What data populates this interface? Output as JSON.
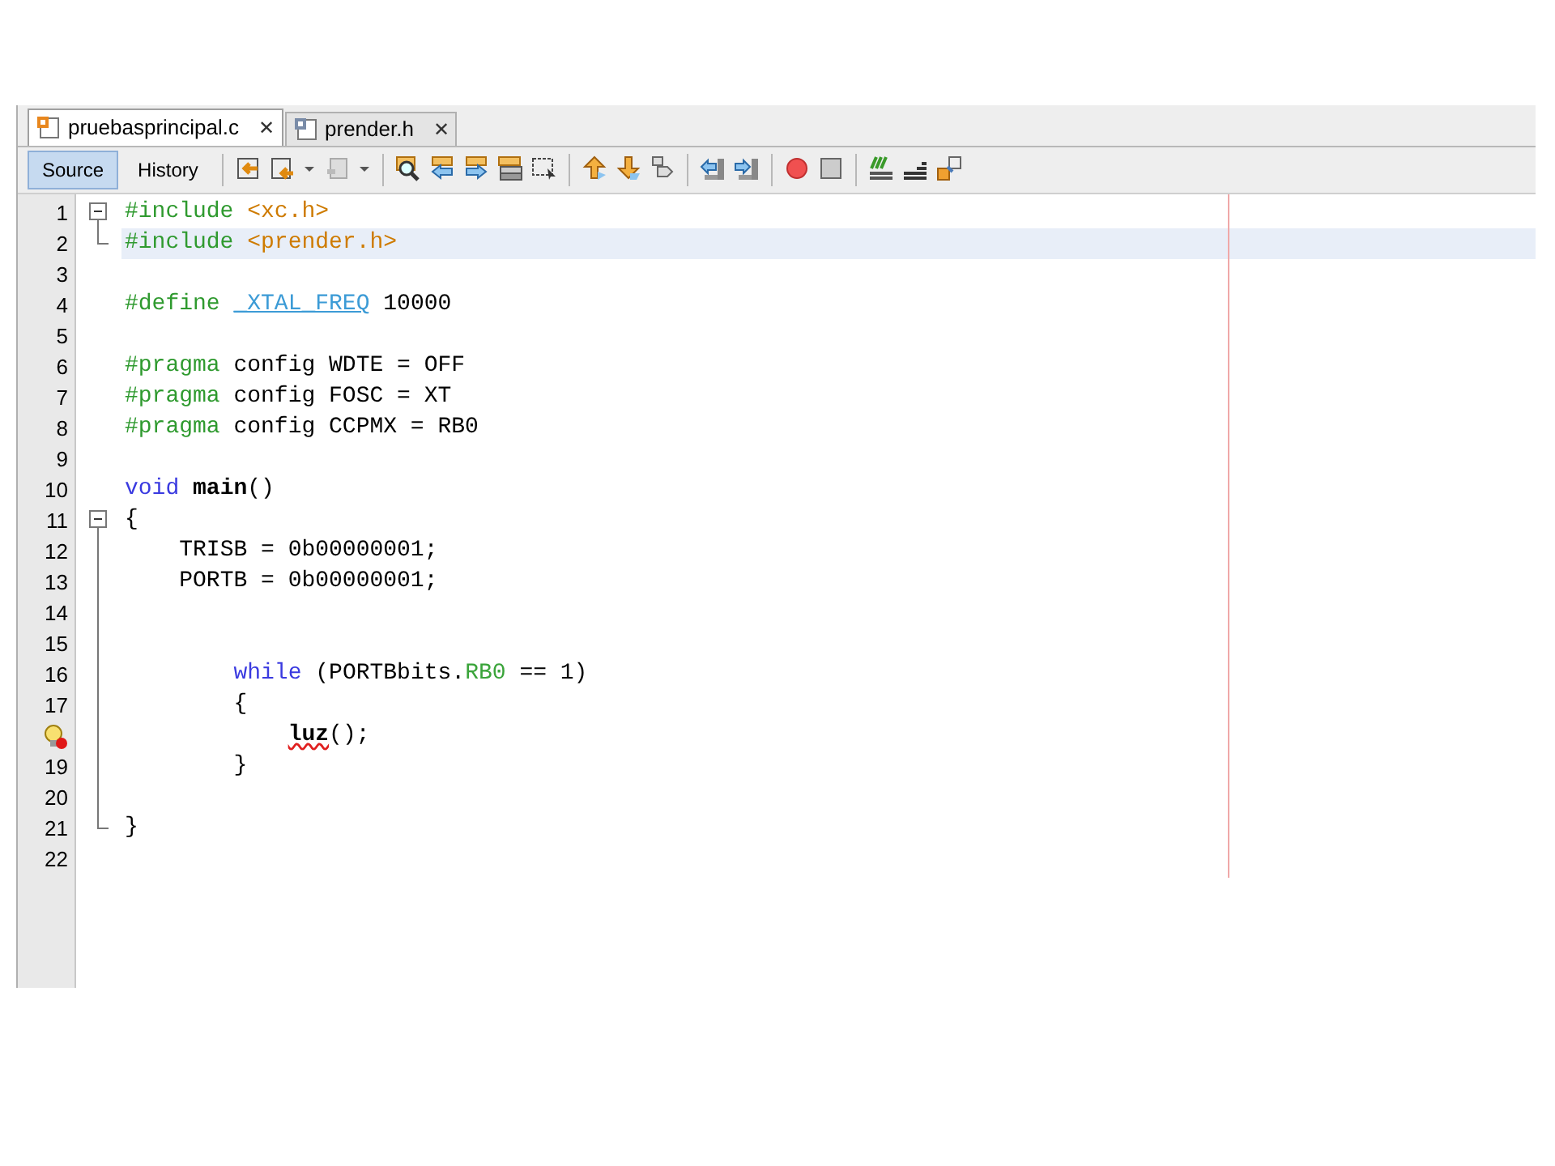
{
  "tabs": [
    {
      "label": "pruebasprincipal.c",
      "selected": true,
      "close": "✕"
    },
    {
      "label": "prender.h",
      "selected": false,
      "close": "✕"
    }
  ],
  "view_buttons": [
    {
      "label": "Source",
      "selected": true
    },
    {
      "label": "History",
      "selected": false
    }
  ],
  "lines": [
    {
      "number": "1",
      "collapsible": true,
      "current": false,
      "tokens": [
        {
          "kind": "preproc",
          "text": "#include"
        },
        {
          "kind": "string",
          "text": " <xc.h>"
        }
      ]
    },
    {
      "number": "2",
      "fold_end": true,
      "current": true,
      "tokens": [
        {
          "kind": "preproc",
          "text": "#include"
        },
        {
          "kind": "string",
          "text": " <prender.h>"
        }
      ]
    },
    {
      "number": "3"
    },
    {
      "number": "4",
      "tokens": [
        {
          "kind": "preproc",
          "text": "#define"
        },
        {
          "kind": "macro",
          "text": " _XTAL_FREQ"
        },
        {
          "kind": "plain",
          "text": " 10000"
        }
      ]
    },
    {
      "number": "5"
    },
    {
      "number": "6",
      "tokens": [
        {
          "kind": "preproc",
          "text": "#pragma"
        },
        {
          "kind": "plain",
          "text": " config WDTE = OFF"
        }
      ]
    },
    {
      "number": "7",
      "tokens": [
        {
          "kind": "preproc",
          "text": "#pragma"
        },
        {
          "kind": "plain",
          "text": " config FOSC = XT"
        }
      ]
    },
    {
      "number": "8",
      "tokens": [
        {
          "kind": "preproc",
          "text": "#pragma"
        },
        {
          "kind": "plain",
          "text": " config CCPMX = RB0"
        }
      ]
    },
    {
      "number": "9"
    },
    {
      "number": "10",
      "tokens": [
        {
          "kind": "keyword",
          "text": "void"
        },
        {
          "kind": "function",
          "text": " main"
        },
        {
          "kind": "plain",
          "text": "()"
        }
      ]
    },
    {
      "number": "11",
      "collapsible": true,
      "tokens": [
        {
          "kind": "plain",
          "text": "{"
        }
      ]
    },
    {
      "number": "12",
      "tokens": [
        {
          "kind": "plain",
          "text": "    TRISB = 0b00000001;"
        }
      ]
    },
    {
      "number": "13",
      "tokens": [
        {
          "kind": "plain",
          "text": "    PORTB = 0b00000001;"
        }
      ]
    },
    {
      "number": "14"
    },
    {
      "number": "15"
    },
    {
      "number": "16",
      "tokens": [
        {
          "kind": "keyword",
          "text": "        while"
        },
        {
          "kind": "plain",
          "text": " (PORTBbits."
        },
        {
          "kind": "member",
          "text": "RB0"
        },
        {
          "kind": "plain",
          "text": " == 1)"
        }
      ]
    },
    {
      "number": "17",
      "tokens": [
        {
          "kind": "plain",
          "text": "        {"
        }
      ]
    },
    {
      "hint": true,
      "tokens": [
        {
          "kind": "error",
          "text": "            luz"
        },
        {
          "kind": "plain",
          "text": "();"
        }
      ]
    },
    {
      "number": "19",
      "tokens": [
        {
          "kind": "plain",
          "text": "        }"
        }
      ]
    },
    {
      "number": "20"
    },
    {
      "number": "21",
      "fold_end": true,
      "tokens": [
        {
          "kind": "plain",
          "text": "}"
        }
      ]
    },
    {
      "number": "22"
    }
  ]
}
